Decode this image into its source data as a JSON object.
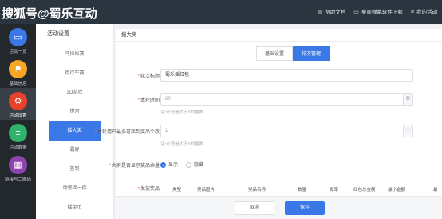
{
  "brand": "搜狐号@蜀乐互动",
  "top_links": [
    {
      "icon": "doc-icon",
      "glyph": "▤",
      "label": "帮助文档"
    },
    {
      "icon": "desktop-icon",
      "glyph": "▭",
      "label": "桌面弹幕软件下载"
    },
    {
      "icon": "list-icon",
      "glyph": "≡",
      "label": "我的活动"
    }
  ],
  "nav": [
    {
      "label": "活动一览",
      "color": "#3a78e7",
      "glyph": "▭",
      "icon": "monitor-icon"
    },
    {
      "label": "基础信息",
      "color": "#f5a623",
      "glyph": "⚑",
      "icon": "flag-icon"
    },
    {
      "label": "活动设置",
      "color": "#e8412c",
      "glyph": "⚙",
      "icon": "gear-icon"
    },
    {
      "label": "活动数据",
      "color": "#2fb36b",
      "glyph": "≡",
      "icon": "database-icon"
    },
    {
      "label": "链接与二维码",
      "color": "#8e44ad",
      "glyph": "▦",
      "icon": "qrcode-icon"
    }
  ],
  "subnav": {
    "title": "活动设置",
    "items": [
      "马拉松赛",
      "街行车赛",
      "3D游戏",
      "拔河",
      "摇大奖",
      "霸屏",
      "签到",
      "动感摇一摇",
      "摇金币"
    ],
    "active_index": 4
  },
  "main": {
    "title": "摇大奖",
    "tabs": [
      "基础设置",
      "轮次管理"
    ],
    "active_tab": 1,
    "round_title_label": "轮次标题",
    "round_title_value": "蜀乐摇红包",
    "duration_label": "本轮时间",
    "duration_placeholder": "60",
    "duration_unit": "秒",
    "duration_hint": "注:必须是大于0的整数",
    "max_prize_label": "本轮用户最多可摇到奖品个数",
    "max_prize_placeholder": "1",
    "max_prize_unit": "个",
    "max_prize_hint": "注:必须是大于0的整数",
    "screen_label": "大屏是否显示奖品余量",
    "show_option": "显示",
    "hide_option": "隐藏",
    "show_selected": true,
    "prize_label": "发放奖品",
    "table_headers": [
      "类型",
      "奖品图片",
      "奖品名称",
      "数量",
      "概率",
      "红包总金额",
      "最小金额",
      "最"
    ]
  },
  "footer": {
    "cancel": "取消",
    "save": "保存"
  }
}
